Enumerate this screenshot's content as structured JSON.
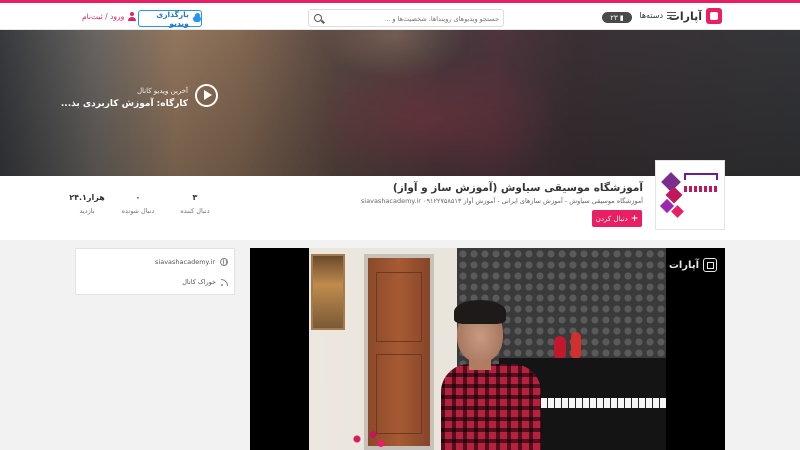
{
  "header": {
    "logo_text": "آپارات",
    "categories_label": "دسته‌ها",
    "badge_count": "۲۳",
    "search_placeholder": "جستجو ویدیوهای روینداها، شخصیت‌ها و ...",
    "upload_label": "بارگذاری ویدیو",
    "login_label": "ورود / ثبت‌نام"
  },
  "banner": {
    "latest_label": "آخرین ویدیو کانال",
    "latest_title": "کارگاه: آموزش کاربردی بذ..."
  },
  "channel": {
    "title": "آموزشگاه موسیقی سیاوش (آموزش ساز و آواز)",
    "description": "آموزشگاه موسیقی سیاوش - آموزش سازهای ایرانی - آموزش آواز ۰۹۱۲۲۷۵۸۵۱۳ siavashacademy.ir",
    "follow_label": "دنبال کردن",
    "stats": [
      {
        "value": "۳",
        "label": "دنبال کننده"
      },
      {
        "value": "۰",
        "label": "دنبال شونده"
      },
      {
        "value": "۲۴.۱هزار",
        "label": "بازدید"
      }
    ]
  },
  "sidebar": {
    "website": "siavashacademy.ir",
    "feed_label": "خوراک کانال"
  },
  "player": {
    "watermark": "آپارات"
  },
  "colors": {
    "accent": "#e91e63",
    "upload_blue": "#2196f3"
  }
}
